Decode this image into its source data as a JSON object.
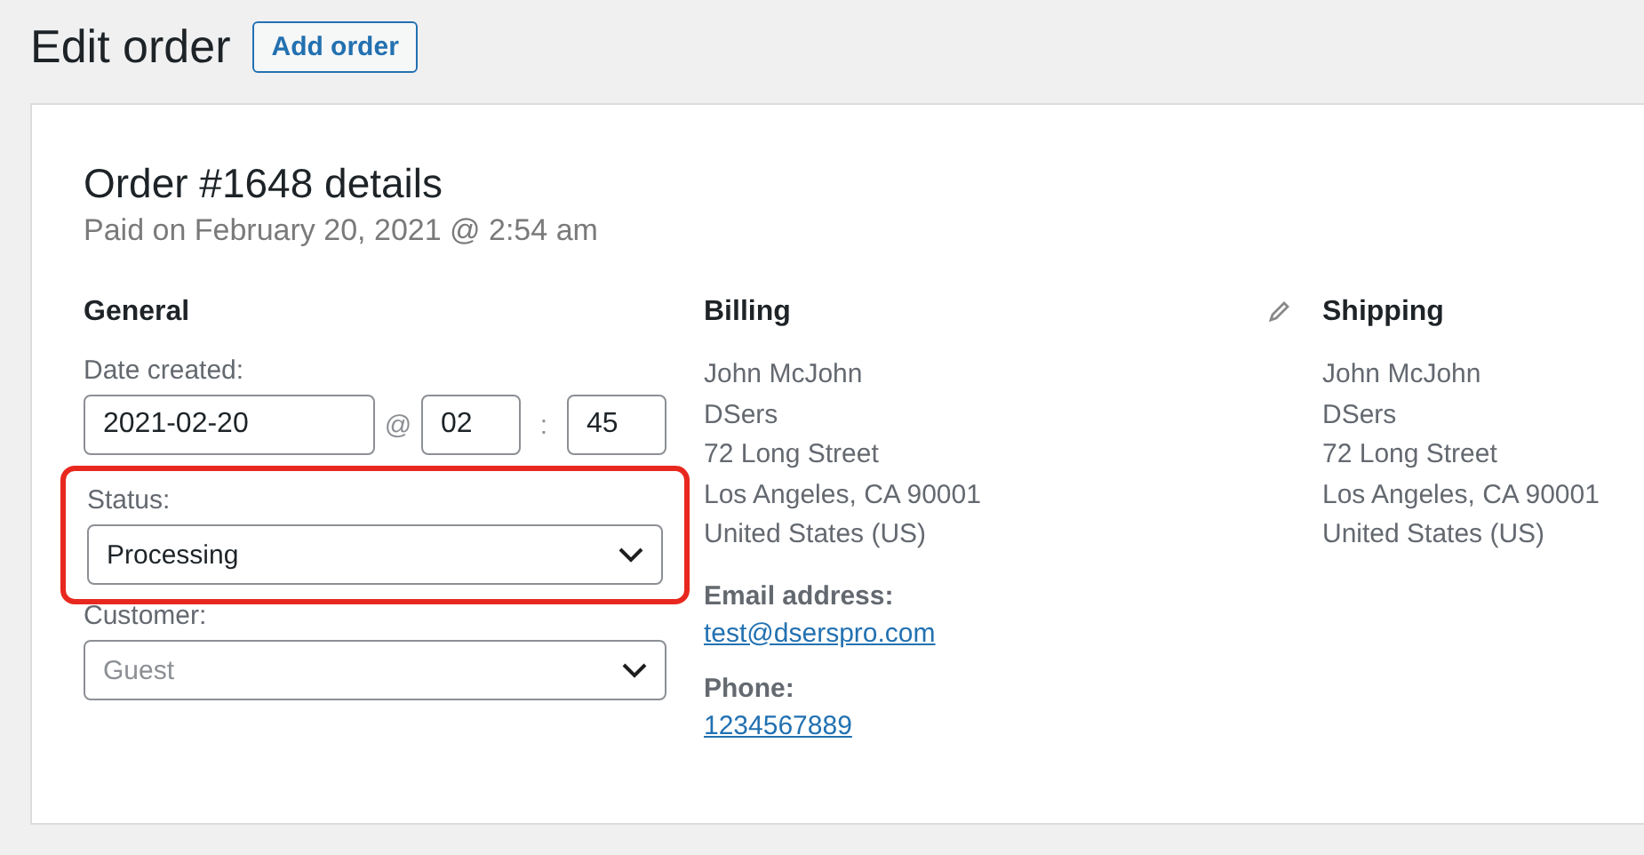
{
  "page": {
    "title": "Edit order",
    "add_button": "Add order"
  },
  "order": {
    "heading": "Order #1648 details",
    "paid_line": "Paid on February 20, 2021 @ 2:54 am"
  },
  "general": {
    "heading": "General",
    "date_label": "Date created:",
    "date": "2021-02-20",
    "at": "@",
    "hour": "02",
    "colon": ":",
    "minute": "45",
    "status": {
      "label": "Status:",
      "value": "Processing",
      "highlighted": true
    },
    "customer": {
      "label": "Customer:",
      "placeholder": "Guest"
    }
  },
  "billing": {
    "heading": "Billing",
    "address": [
      "John McJohn",
      "DSers",
      "72 Long Street",
      "Los Angeles, CA 90001",
      "United States (US)"
    ],
    "email_label": "Email address:",
    "email": "test@dserspro.com",
    "phone_label": "Phone:",
    "phone": "1234567889"
  },
  "shipping": {
    "heading": "Shipping",
    "address": [
      "John McJohn",
      "DSers",
      "72 Long Street",
      "Los Angeles, CA 90001",
      "United States (US)"
    ]
  }
}
